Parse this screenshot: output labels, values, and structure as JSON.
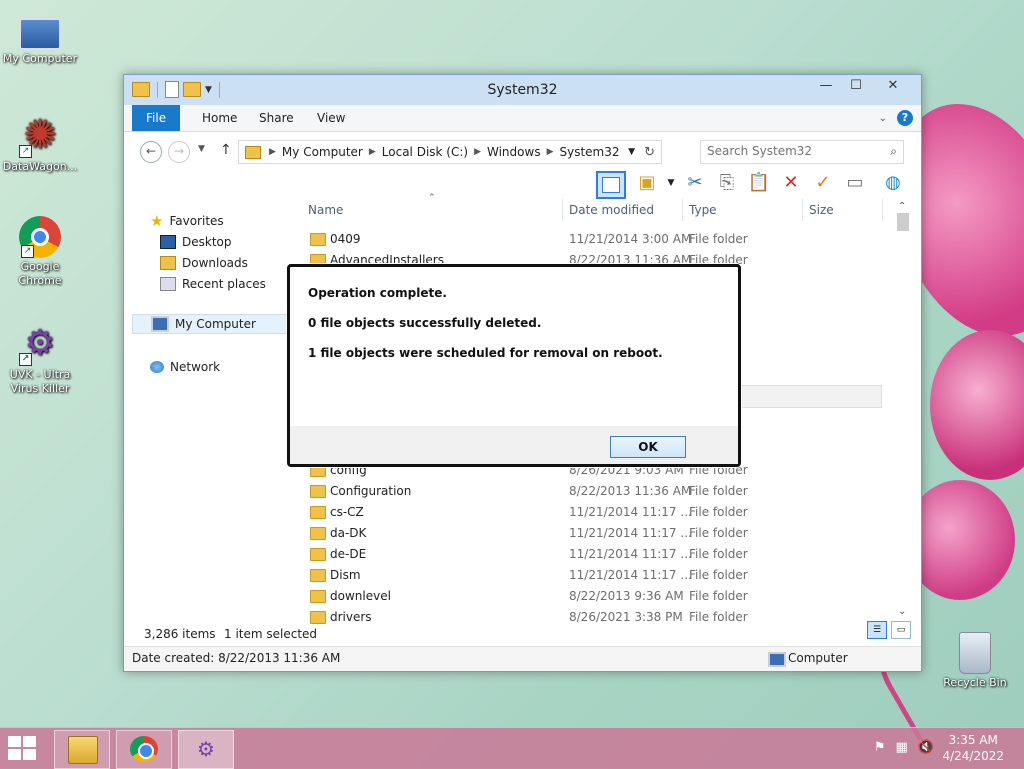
{
  "desktop": {
    "icons": [
      {
        "label": "My Computer",
        "icon": "computer-icon"
      },
      {
        "label": "DataWagon...",
        "icon": "datawagon-icon"
      },
      {
        "label": "Google Chrome",
        "icon": "chrome-icon"
      },
      {
        "label": "UVK - Ultra Virus Killer",
        "icon": "uvk-icon"
      },
      {
        "label": "Recycle Bin",
        "icon": "recycle-bin-icon"
      }
    ]
  },
  "explorer": {
    "title": "System32",
    "ribbon_tabs": [
      "File",
      "Home",
      "Share",
      "View"
    ],
    "address": {
      "crumbs": [
        "My Computer",
        "Local Disk (C:)",
        "Windows",
        "System32"
      ]
    },
    "search": {
      "placeholder": "Search System32"
    },
    "nav": {
      "favorites": "Favorites",
      "desktop": "Desktop",
      "downloads": "Downloads",
      "recent": "Recent places",
      "computer": "My Computer",
      "network": "Network"
    },
    "columns": {
      "name": "Name",
      "date": "Date modified",
      "type": "Type",
      "size": "Size"
    },
    "rows": [
      {
        "name": "0409",
        "date": "11/21/2014 3:00 AM",
        "type": "File folder"
      },
      {
        "name": "AdvancedInstallers",
        "date": "8/22/2013 11:36 AM",
        "type": "File folder"
      },
      {
        "name": "config",
        "date": "8/26/2021 9:03 AM",
        "type": "File folder"
      },
      {
        "name": "Configuration",
        "date": "8/22/2013 11:36 AM",
        "type": "File folder"
      },
      {
        "name": "cs-CZ",
        "date": "11/21/2014 11:17 ...",
        "type": "File folder"
      },
      {
        "name": "da-DK",
        "date": "11/21/2014 11:17 ...",
        "type": "File folder"
      },
      {
        "name": "de-DE",
        "date": "11/21/2014 11:17 ...",
        "type": "File folder"
      },
      {
        "name": "Dism",
        "date": "11/21/2014 11:17 ...",
        "type": "File folder"
      },
      {
        "name": "downlevel",
        "date": "8/22/2013 9:36 AM",
        "type": "File folder"
      },
      {
        "name": "drivers",
        "date": "8/26/2021 3:38 PM",
        "type": "File folder"
      }
    ],
    "status": {
      "items": "3,286 items",
      "selected": "1 item selected"
    },
    "details": {
      "created": "Date created: 8/22/2013 11:36 AM",
      "location": "Computer"
    }
  },
  "dialog": {
    "line1": "Operation complete.",
    "line2": "0 file objects successfully deleted.",
    "line3": "1 file objects were scheduled for removal on reboot.",
    "ok_label": "OK"
  },
  "taskbar": {
    "time": "3:35 AM",
    "date": "4/24/2022"
  },
  "colors": {
    "accent": "#1979ca",
    "titlebar": "#cbe1f3",
    "taskbar": "#c97896"
  }
}
